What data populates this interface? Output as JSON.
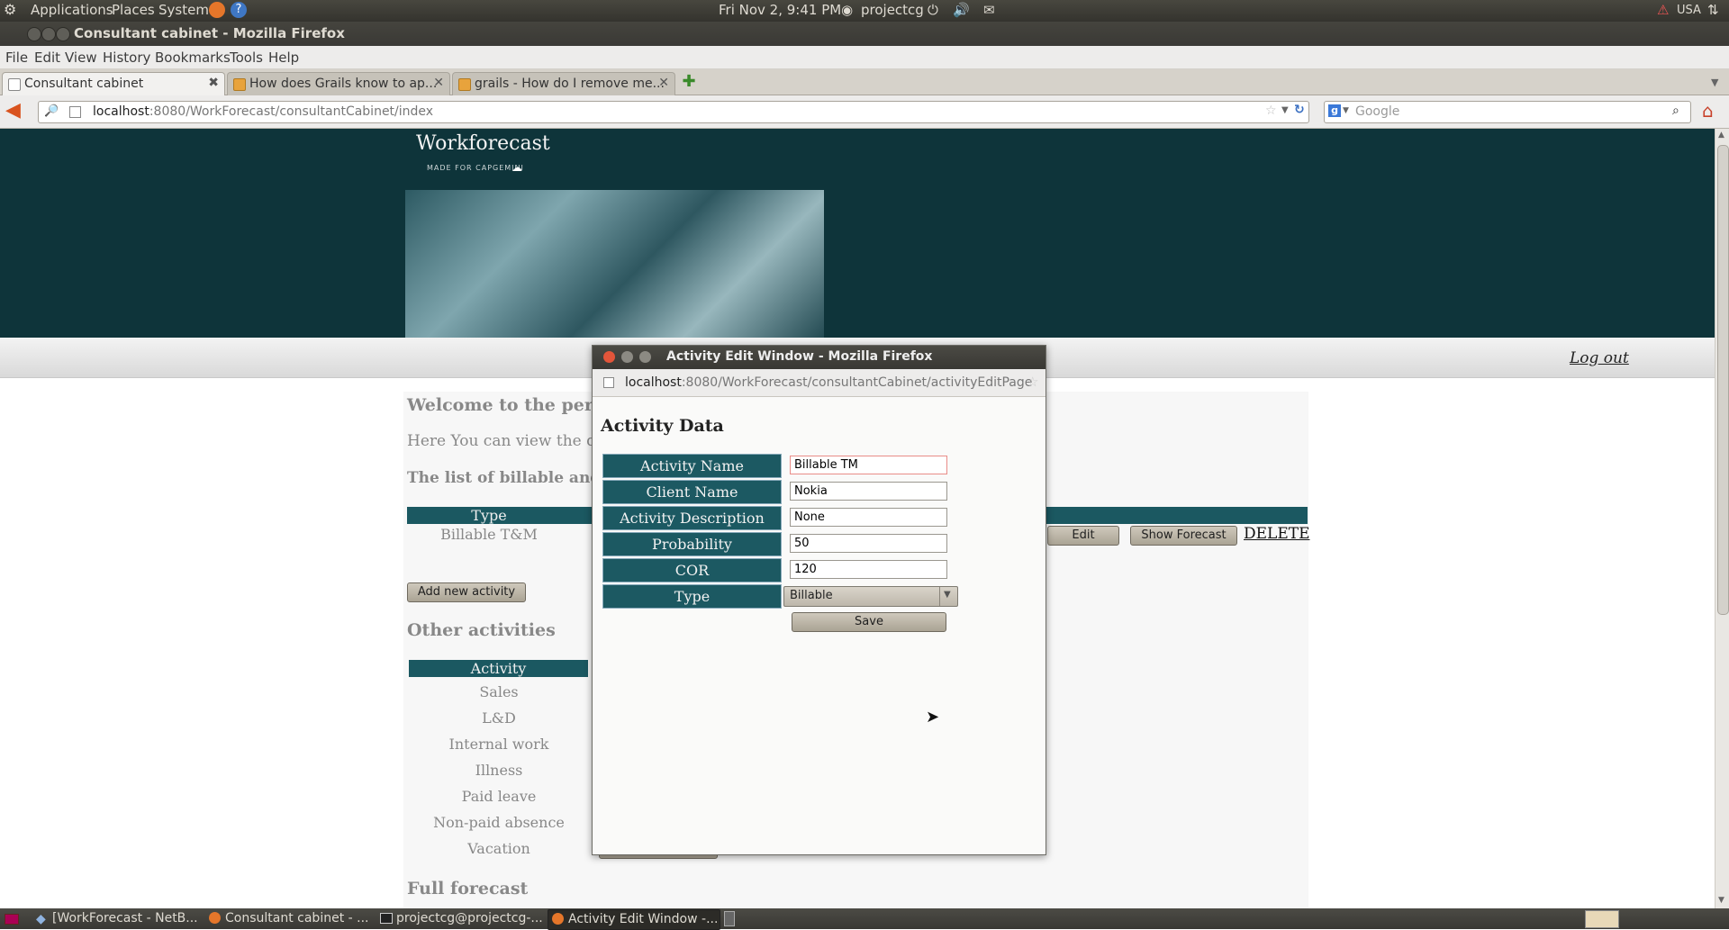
{
  "top_panel": {
    "menus": [
      "Applications",
      "Places",
      "System"
    ],
    "clock": "Fri Nov  2,  9:41 PM",
    "user": "projectcg",
    "keyboard_layout": "USA"
  },
  "window": {
    "title": "Consultant cabinet - Mozilla Firefox"
  },
  "menubar": [
    "File",
    "Edit",
    "View",
    "History",
    "Bookmarks",
    "Tools",
    "Help"
  ],
  "tabs": [
    {
      "label": "Consultant cabinet"
    },
    {
      "label": "How does Grails know to ap..."
    },
    {
      "label": "grails - How do I remove me..."
    }
  ],
  "navbar": {
    "url_host": "localhost",
    "url_rest": ":8080/WorkForecast/consultantCabinet/index",
    "search_placeholder": "Google"
  },
  "site": {
    "logo": "Workforecast",
    "logo_sub": "MADE FOR CAPGEMINI",
    "logout": "Log out",
    "welcome": "Welcome to the per",
    "intro": "Here You can view the de",
    "billable_heading": "The list of billable and",
    "billable_table": {
      "header_type": "Type",
      "row_type": "Billable T&M",
      "edit": "Edit",
      "show_forecast": "Show Forecast",
      "delete": "DELETE"
    },
    "add_activity": "Add new activity",
    "other_heading": "Other activities",
    "other_header": "Activity",
    "other_rows": [
      "Sales",
      "L&D",
      "Internal work",
      "Illness",
      "Paid leave",
      "Non-paid absence",
      "Vacation"
    ],
    "show_forecast": "Show Forecast",
    "full_forecast": "Full forecast"
  },
  "popup": {
    "title": "Activity Edit Window - Mozilla Firefox",
    "url_host": "localhost",
    "url_rest": ":8080/WorkForecast/consultantCabinet/activityEditPage",
    "heading": "Activity Data",
    "fields": [
      {
        "label": "Activity Name",
        "value": "Billable TM"
      },
      {
        "label": "Client Name",
        "value": "Nokia"
      },
      {
        "label": "Activity Description",
        "value": "None"
      },
      {
        "label": "Probability",
        "value": "50"
      },
      {
        "label": "COR",
        "value": "120"
      }
    ],
    "type_label": "Type",
    "type_value": "Billable",
    "save": "Save"
  },
  "taskbar": [
    {
      "label": "[WorkForecast - NetB..."
    },
    {
      "label": "Consultant cabinet - ..."
    },
    {
      "label": "projectcg@projectcg-..."
    },
    {
      "label": "Activity Edit Window -..."
    }
  ],
  "colors": {
    "header": "#0e343a",
    "table_header": "#1b5861",
    "button": "#bdb6a8"
  }
}
